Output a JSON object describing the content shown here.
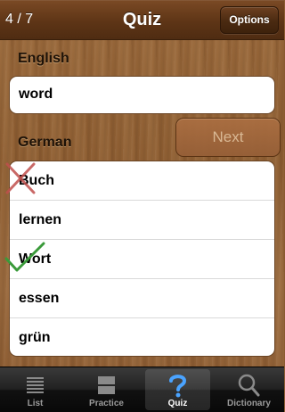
{
  "nav": {
    "counter": "4 / 7",
    "title": "Quiz",
    "options_label": "Options"
  },
  "quiz": {
    "source_language_label": "English",
    "source_word": "word",
    "target_language_label": "German",
    "next_label": "Next",
    "choices": [
      {
        "text": "Buch",
        "mark": "wrong-x-icon"
      },
      {
        "text": "lernen",
        "mark": ""
      },
      {
        "text": "Wort",
        "mark": "correct-check-icon"
      },
      {
        "text": "essen",
        "mark": ""
      },
      {
        "text": "grün",
        "mark": ""
      }
    ]
  },
  "tabbar": {
    "selected": "Quiz",
    "tabs": [
      {
        "label": "List",
        "icon": "list-icon"
      },
      {
        "label": "Practice",
        "icon": "practice-icon"
      },
      {
        "label": "Quiz",
        "icon": "question-icon"
      },
      {
        "label": "Dictionary",
        "icon": "magnifier-icon"
      }
    ]
  },
  "colors": {
    "wrong": "#c0504d",
    "correct": "#3a9a3a",
    "quiz_tab_icon": "#4aa3ff"
  }
}
